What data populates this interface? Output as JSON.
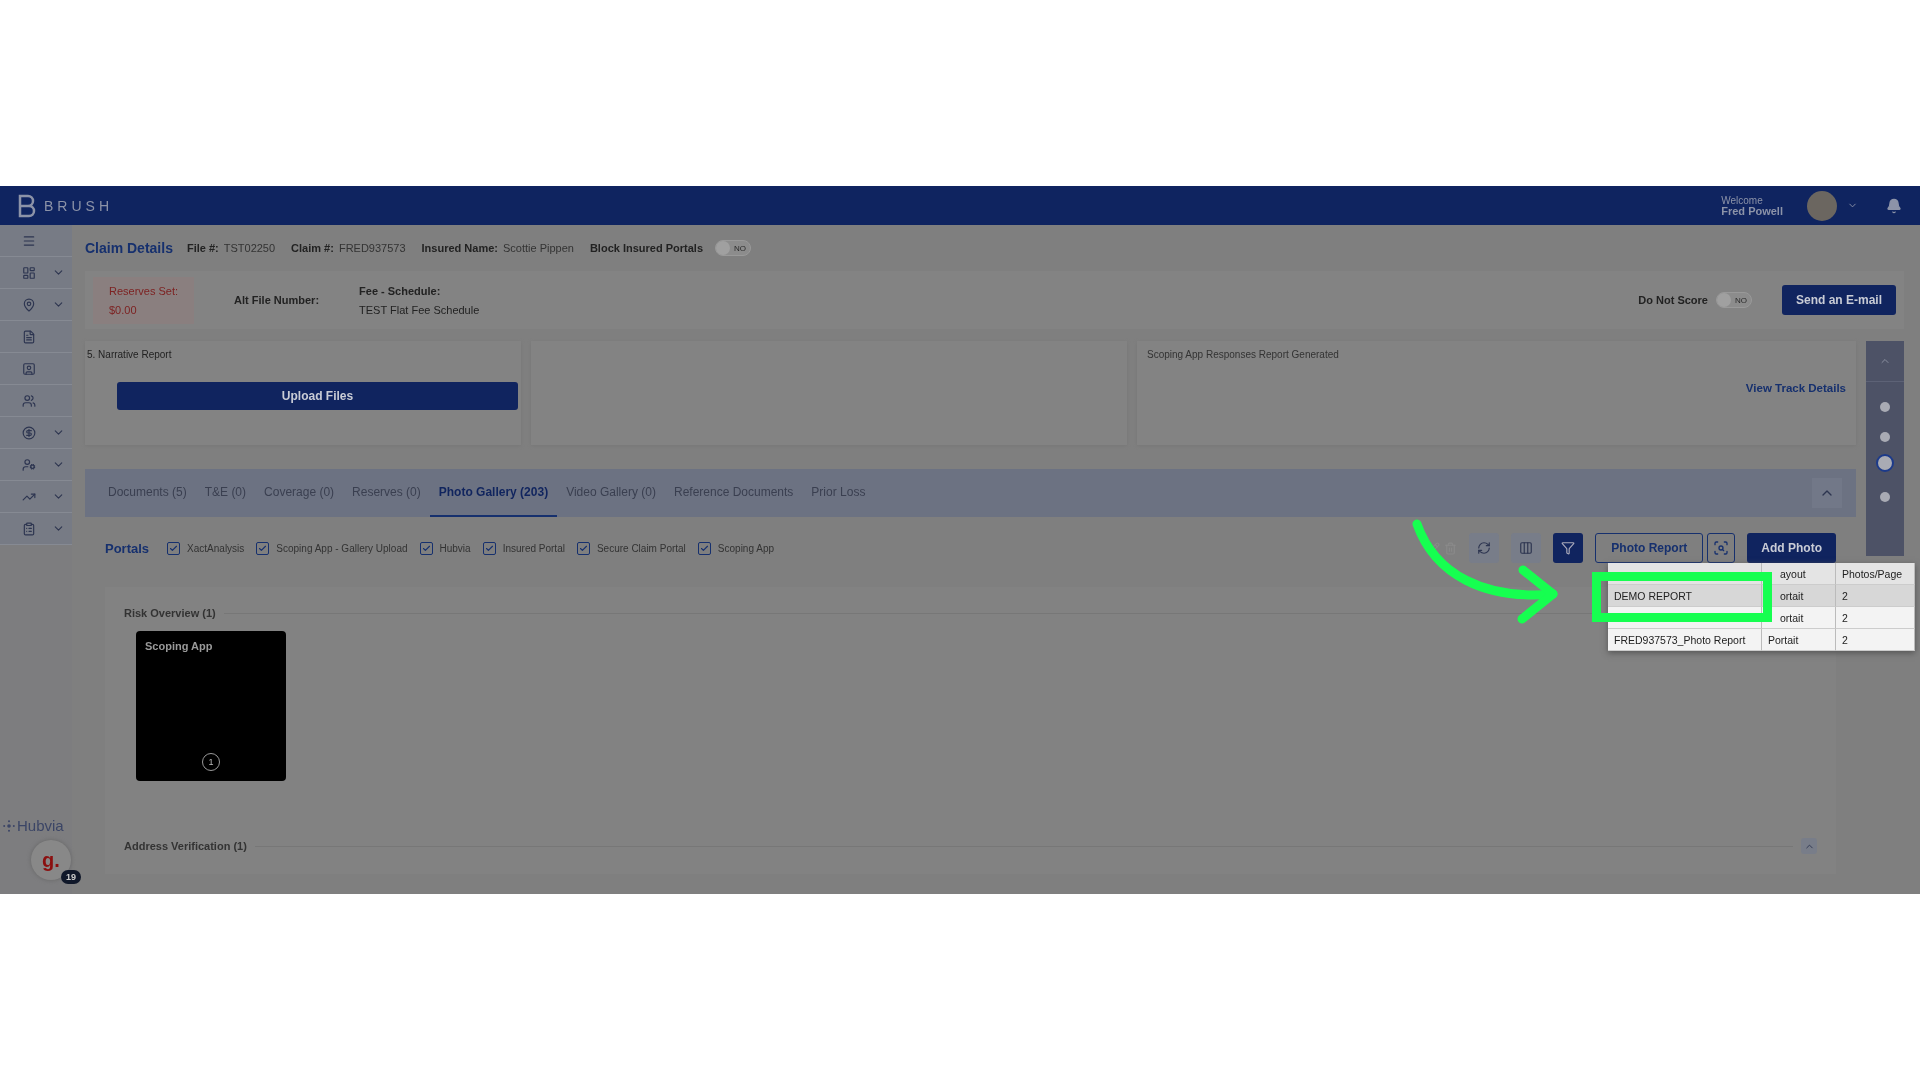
{
  "app": {
    "logo": "BRUSH"
  },
  "user": {
    "greeting": "Welcome",
    "name": "Fred Powell"
  },
  "sidebar": {
    "items": [
      {
        "expandable": true
      },
      {
        "expandable": true
      },
      {
        "expandable": false
      },
      {
        "expandable": false
      },
      {
        "expandable": false
      },
      {
        "expandable": true
      },
      {
        "expandable": true
      },
      {
        "expandable": true
      },
      {
        "expandable": true
      }
    ]
  },
  "footer": {
    "partner": "Hubvia",
    "chat_initial": "g.",
    "chat_badge": "19"
  },
  "claim": {
    "title": "Claim Details",
    "fields": [
      {
        "label": "File #:",
        "value": "TST02250"
      },
      {
        "label": "Claim #:",
        "value": "FRED937573"
      },
      {
        "label": "Insured Name:",
        "value": "Scottie Pippen"
      }
    ],
    "block_portals": {
      "label": "Block Insured Portals",
      "on": false,
      "state_text": "NO"
    }
  },
  "summary": {
    "reserves": {
      "label": "Reserves Set:",
      "value": "$0.00"
    },
    "alt_file": {
      "label": "Alt File Number:"
    },
    "fee": {
      "label": "Fee - Schedule:",
      "value": "TEST Flat Fee Schedule"
    },
    "do_not_score": {
      "label": "Do Not Score",
      "on": false,
      "state_text": "NO"
    },
    "email_button": "Send an E-mail"
  },
  "cards": {
    "narrative": "5. Narrative Report",
    "upload_button": "Upload Files",
    "track_entry": "Scoping App Responses Report Generated",
    "track_link": "View Track Details"
  },
  "rail": {
    "dots": [
      {
        "selected": false
      },
      {
        "selected": false
      },
      {
        "selected": true
      },
      {
        "selected": false
      }
    ]
  },
  "tabs": [
    {
      "label": "Documents (5)",
      "selected": false
    },
    {
      "label": "T&E (0)",
      "selected": false
    },
    {
      "label": "Coverage (0)",
      "selected": false
    },
    {
      "label": "Reserves (0)",
      "selected": false
    },
    {
      "label": "Photo Gallery (203)",
      "selected": true
    },
    {
      "label": "Video Gallery (0)",
      "selected": false
    },
    {
      "label": "Reference Documents",
      "selected": false
    },
    {
      "label": "Prior Loss",
      "selected": false
    }
  ],
  "portals": {
    "label": "Portals",
    "items": [
      {
        "label": "XactAnalysis",
        "checked": true
      },
      {
        "label": "Scoping App - Gallery Upload",
        "checked": true
      },
      {
        "label": "Hubvia",
        "checked": true
      },
      {
        "label": "Insured Portal",
        "checked": true
      },
      {
        "label": "Secure Claim Portal",
        "checked": true
      },
      {
        "label": "Scoping App",
        "checked": true
      }
    ]
  },
  "toolbar": {
    "filter_active": true,
    "report_button": "Photo Report",
    "add_button": "Add Photo"
  },
  "report_menu": {
    "columns": [
      "ayout",
      "Photos/Page"
    ],
    "rows": [
      {
        "name": "DEMO REPORT",
        "layout": "ortait",
        "photos": "2",
        "selected": true
      },
      {
        "layout": "ortait",
        "photos": "2",
        "selected": false
      },
      {
        "name": "FRED937573_Photo Report",
        "layout": "Portait",
        "photos": "2",
        "selected": false
      }
    ]
  },
  "gallery": {
    "sections": [
      {
        "title": "Risk Overview (1)",
        "photos": [
          {
            "caption": "Scoping App",
            "count": "1"
          }
        ]
      },
      {
        "title": "Address Verification (1)",
        "expanded": true
      }
    ]
  }
}
